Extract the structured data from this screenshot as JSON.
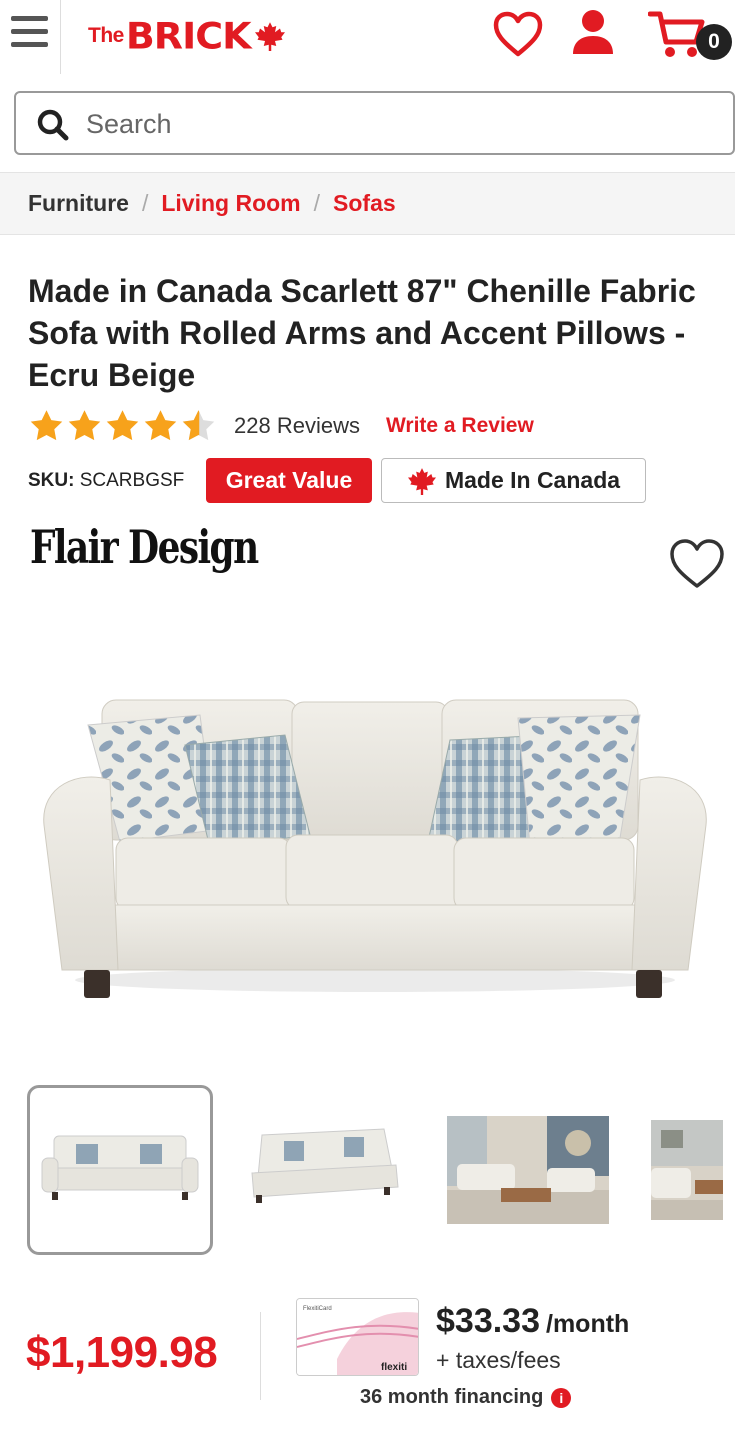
{
  "header": {
    "logo_the": "The",
    "logo_brick": "BRICK",
    "cart_count": "0",
    "brand_color": "#e11b22"
  },
  "search": {
    "placeholder": "Search"
  },
  "breadcrumb": {
    "items": [
      "Furniture",
      "Living Room",
      "Sofas"
    ],
    "separator": "/"
  },
  "product": {
    "title": "Made in Canada Scarlett 87\" Chenille Fabric Sofa with Rolled Arms and Accent Pillows - Ecru Beige",
    "rating": 4.5,
    "review_count": "228 Reviews",
    "write_review": "Write a Review",
    "sku_label": "SKU:",
    "sku_value": "SCARBGSF",
    "badge_value": "Great Value",
    "badge_canada": "Made In Canada",
    "brand": "Flair Design"
  },
  "pricing": {
    "price": "$1,199.98",
    "monthly_amount": "$33.33",
    "monthly_per": "/month",
    "taxes": "+ taxes/fees",
    "financing": "36 month financing",
    "flexiti_card_title": "FlexitiCard",
    "flexiti_card_name": "flexiti"
  },
  "icons": {
    "menu": "hamburger-icon",
    "wishlist": "heart-icon",
    "account": "user-icon",
    "cart": "cart-icon",
    "search": "search-icon",
    "info": "info-icon"
  }
}
